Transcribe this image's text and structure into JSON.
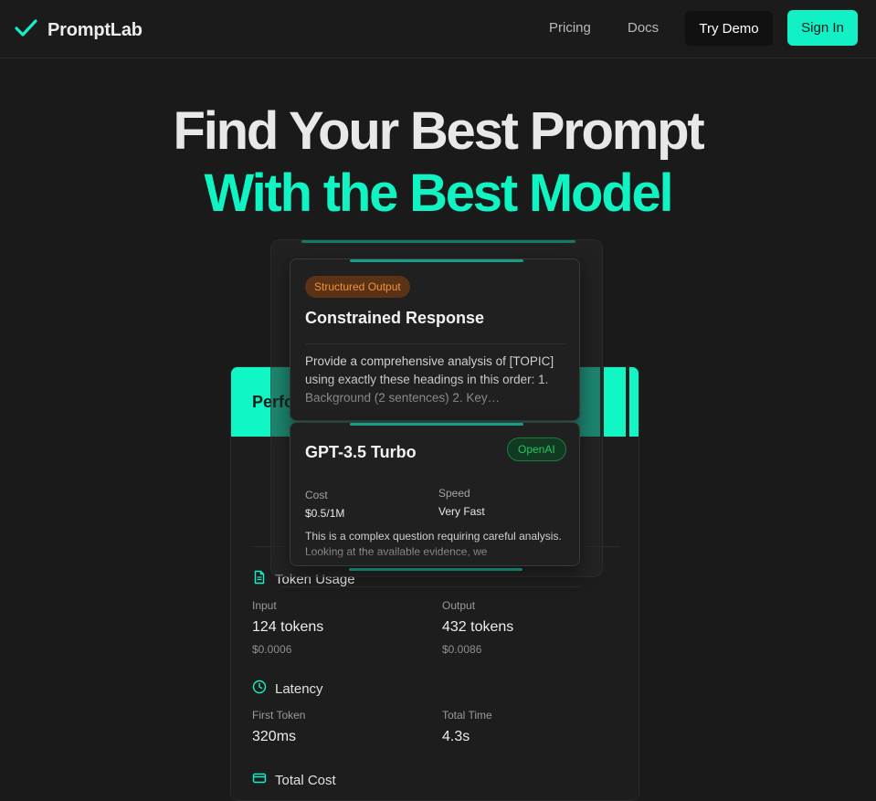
{
  "nav": {
    "brand": "PromptLab",
    "links": [
      "Pricing",
      "Docs"
    ],
    "demo_label": "Try Demo",
    "signin_label": "Sign In"
  },
  "hero": {
    "line1": "Find Your Best Prompt",
    "line2": "With the Best Model"
  },
  "colors": {
    "accent": "#10f3c2",
    "background": "#1a1a1a"
  },
  "prompt_card": {
    "badge": "Structured Output",
    "title": "Constrained Response",
    "body": "Provide a comprehensive analysis of [TOPIC] using exactly these headings in this order: 1. Background (2 sentences) 2. Key…"
  },
  "model_card": {
    "name": "GPT-3.5 Turbo",
    "provider": "OpenAI",
    "cost_label": "Cost",
    "cost_value": "$0.5/1M",
    "speed_label": "Speed",
    "speed_value": "Very Fast",
    "body": "This is a complex question requiring careful analysis. Looking at the available evidence, we"
  },
  "performance": {
    "title": "Perfo",
    "token_usage": {
      "title": "Token Usage",
      "input_label": "Input",
      "input_value": "124 tokens",
      "input_cost": "$0.0006",
      "output_label": "Output",
      "output_value": "432 tokens",
      "output_cost": "$0.0086"
    },
    "latency": {
      "title": "Latency",
      "first_label": "First Token",
      "first_value": "320ms",
      "total_label": "Total Time",
      "total_value": "4.3s"
    },
    "total_cost": {
      "title": "Total Cost"
    }
  }
}
